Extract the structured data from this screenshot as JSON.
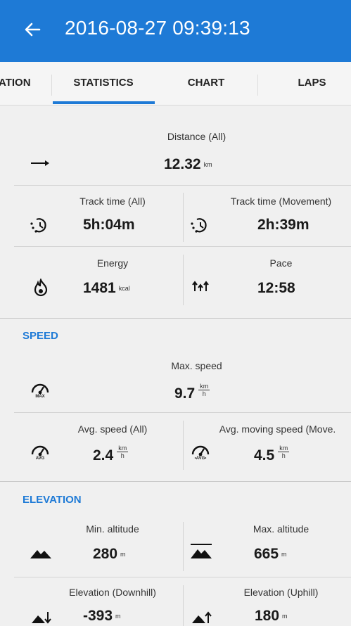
{
  "header": {
    "title": "2016-08-27 09:39:13"
  },
  "tabs": [
    {
      "label": "ATION"
    },
    {
      "label": "STATISTICS"
    },
    {
      "label": "CHART"
    },
    {
      "label": "LAPS"
    }
  ],
  "distance": {
    "label": "Distance (All)",
    "value": "12.32",
    "unit": "km"
  },
  "track_time_all": {
    "label": "Track time (All)",
    "value": "5h:04m"
  },
  "track_time_movement": {
    "label": "Track time (Movement)",
    "value": "2h:39m"
  },
  "energy": {
    "label": "Energy",
    "value": "1481",
    "unit": "kcal"
  },
  "pace": {
    "label": "Pace",
    "value": "12:58"
  },
  "speed_section": {
    "title": "SPEED",
    "max_speed": {
      "label": "Max. speed",
      "value": "9.7",
      "unit_num": "km",
      "unit_den": "h",
      "icon_text": "MAX"
    },
    "avg_speed": {
      "label": "Avg. speed (All)",
      "value": "2.4",
      "unit_num": "km",
      "unit_den": "h",
      "icon_text": "AVG"
    },
    "avg_moving_speed": {
      "label": "Avg. moving speed (Move.",
      "value": "4.5",
      "unit_num": "km",
      "unit_den": "h",
      "icon_text": "•AVG•"
    }
  },
  "elevation_section": {
    "title": "ELEVATION",
    "min_altitude": {
      "label": "Min. altitude",
      "value": "280",
      "unit": "m"
    },
    "max_altitude": {
      "label": "Max. altitude",
      "value": "665",
      "unit": "m"
    },
    "elevation_downhill": {
      "label": "Elevation (Downhill)",
      "value": "-393",
      "unit": "m"
    },
    "elevation_uphill": {
      "label": "Elevation (Uphill)",
      "value": "180",
      "unit": "m"
    }
  },
  "colors": {
    "accent": "#1e7ad6",
    "background": "#f0f0f0",
    "text": "#1a1a1a"
  }
}
